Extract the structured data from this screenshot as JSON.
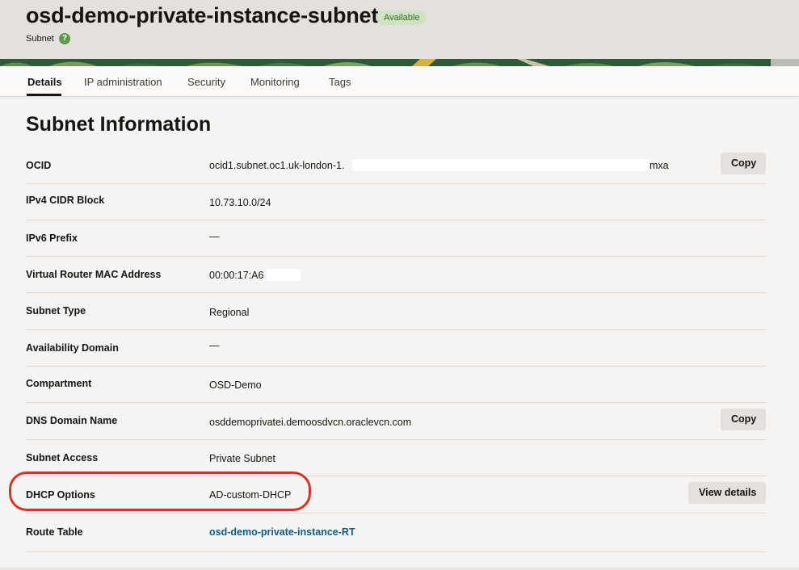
{
  "header": {
    "title": "osd-demo-private-instance-subnet",
    "status": "Available",
    "subtitle": "Subnet",
    "help_icon": "?"
  },
  "tabs": [
    {
      "label": "Details",
      "active": true
    },
    {
      "label": "IP administration",
      "active": false
    },
    {
      "label": "Security",
      "active": false
    },
    {
      "label": "Monitoring",
      "active": false
    },
    {
      "label": "Tags",
      "active": false
    }
  ],
  "section_title": "Subnet Information",
  "rows": [
    {
      "label": "OCID",
      "value_prefix": "ocid1.subnet.oc1.uk-london-1.",
      "value_suffix": "mxa",
      "button": "Copy"
    },
    {
      "label": "IPv4 CIDR Block",
      "value": "10.73.10.0/24"
    },
    {
      "label": "IPv6 Prefix",
      "value": "—"
    },
    {
      "label": "Virtual Router MAC Address",
      "value": "00:00:17:A6"
    },
    {
      "label": "Subnet Type",
      "value": "Regional"
    },
    {
      "label": "Availability Domain",
      "value": "—"
    },
    {
      "label": "Compartment",
      "value": "OSD-Demo"
    },
    {
      "label": "DNS Domain Name",
      "value": "osddemoprivatei.demoosdvcn.oraclevcn.com",
      "button": "Copy"
    },
    {
      "label": "Subnet Access",
      "value": "Private Subnet"
    },
    {
      "label": "DHCP Options",
      "value": "AD-custom-DHCP",
      "button": "View details"
    },
    {
      "label": "Route Table",
      "value": "osd-demo-private-instance-RT",
      "link": true
    }
  ],
  "colors": {
    "accent_link": "#0f5b81",
    "highlight_ring": "#d8332a",
    "status_badge": "#cfe3c2"
  }
}
